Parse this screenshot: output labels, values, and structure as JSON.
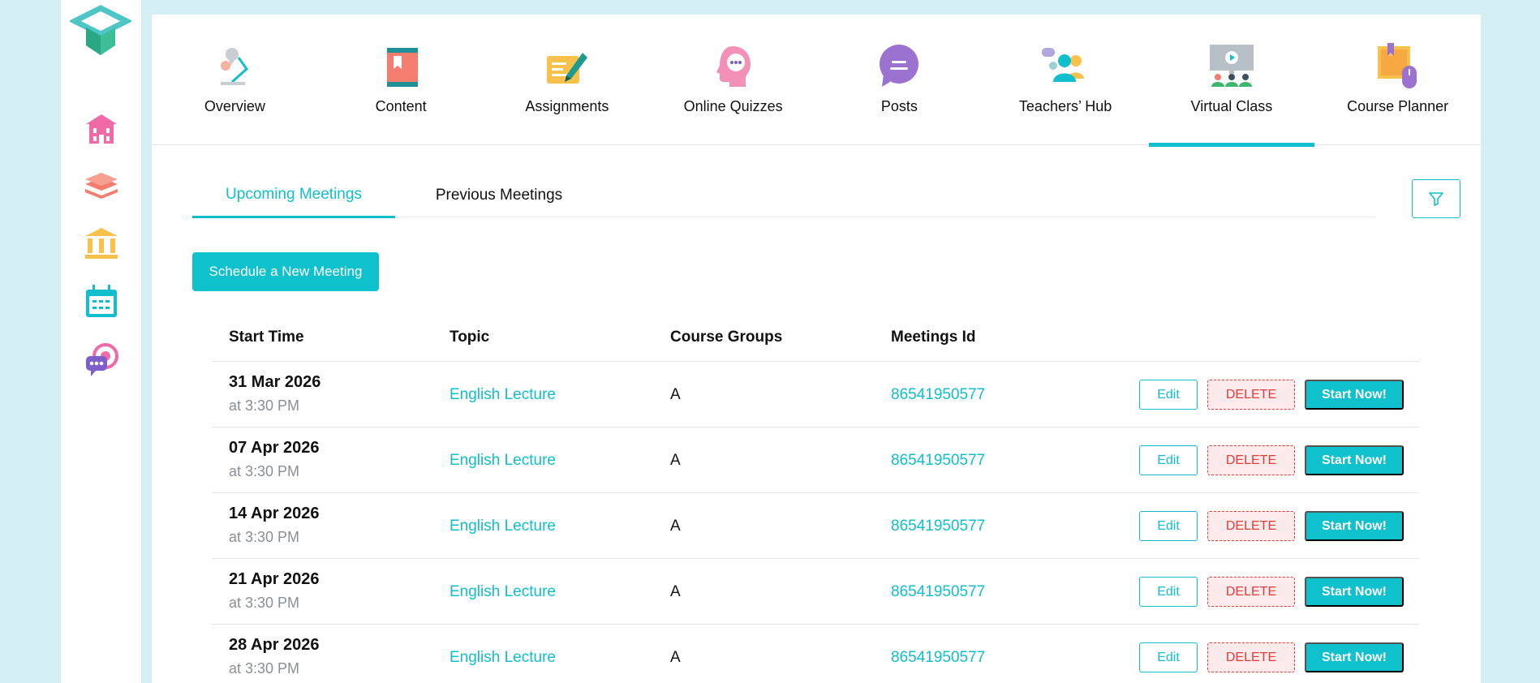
{
  "rail": {
    "icons": [
      "school-icon",
      "layers-icon",
      "institution-icon",
      "calendar-icon",
      "chat-icon"
    ]
  },
  "modules": [
    {
      "label": "Overview",
      "icon": "desk-lamp-icon"
    },
    {
      "label": "Content",
      "icon": "book-icon"
    },
    {
      "label": "Assignments",
      "icon": "pen-paper-icon"
    },
    {
      "label": "Online Quizzes",
      "icon": "thinking-head-icon"
    },
    {
      "label": "Posts",
      "icon": "speech-bubble-icon"
    },
    {
      "label": "Teachers’ Hub",
      "icon": "teachers-group-icon"
    },
    {
      "label": "Virtual Class",
      "icon": "video-class-icon"
    },
    {
      "label": "Course Planner",
      "icon": "planner-icon"
    }
  ],
  "active_module": "Virtual Class",
  "subtabs": {
    "upcoming": "Upcoming Meetings",
    "previous": "Previous Meetings"
  },
  "schedule_button": "Schedule a New Meeting",
  "table": {
    "headers": {
      "start": "Start Time",
      "topic": "Topic",
      "groups": "Course Groups",
      "id": "Meetings Id"
    },
    "rows": [
      {
        "date": "31 Mar 2026",
        "time": "at 3:30 PM",
        "topic": "English Lecture",
        "group": "A",
        "meeting_id": "86541950577"
      },
      {
        "date": "07 Apr 2026",
        "time": "at 3:30 PM",
        "topic": "English Lecture",
        "group": "A",
        "meeting_id": "86541950577"
      },
      {
        "date": "14 Apr 2026",
        "time": "at 3:30 PM",
        "topic": "English Lecture",
        "group": "A",
        "meeting_id": "86541950577"
      },
      {
        "date": "21 Apr 2026",
        "time": "at 3:30 PM",
        "topic": "English Lecture",
        "group": "A",
        "meeting_id": "86541950577"
      },
      {
        "date": "28 Apr 2026",
        "time": "at 3:30 PM",
        "topic": "English Lecture",
        "group": "A",
        "meeting_id": "86541950577"
      }
    ],
    "actions": {
      "edit": "Edit",
      "delete": "DELETE",
      "start": "Start Now!"
    }
  },
  "colors": {
    "accent": "#10bfcb",
    "danger": "#e33b3b",
    "background": "#d3eff3"
  }
}
